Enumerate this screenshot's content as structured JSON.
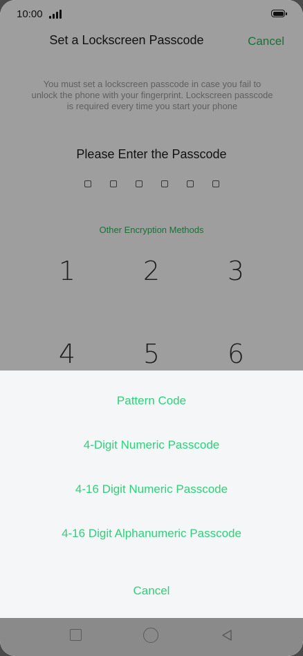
{
  "status_bar": {
    "time": "10:00"
  },
  "header": {
    "title": "Set a Lockscreen Passcode",
    "cancel_label": "Cancel"
  },
  "info_text": "You must set a lockscreen passcode in case you fail to unlock the phone with your fingerprint. Lockscreen passcode is required every time you start your phone",
  "prompt": "Please Enter the Passcode",
  "other_methods_label": "Other Encryption Methods",
  "keypad": {
    "keys": [
      "1",
      "2",
      "3",
      "4",
      "5",
      "6"
    ]
  },
  "sheet": {
    "options": [
      "Pattern Code",
      "4-Digit Numeric Passcode",
      "4-16 Digit Numeric Passcode",
      "4-16 Digit Alphanumeric Passcode"
    ],
    "cancel_label": "Cancel"
  },
  "colors": {
    "accent": "#2fd07a",
    "accent_dimmed": "#2fb457"
  }
}
